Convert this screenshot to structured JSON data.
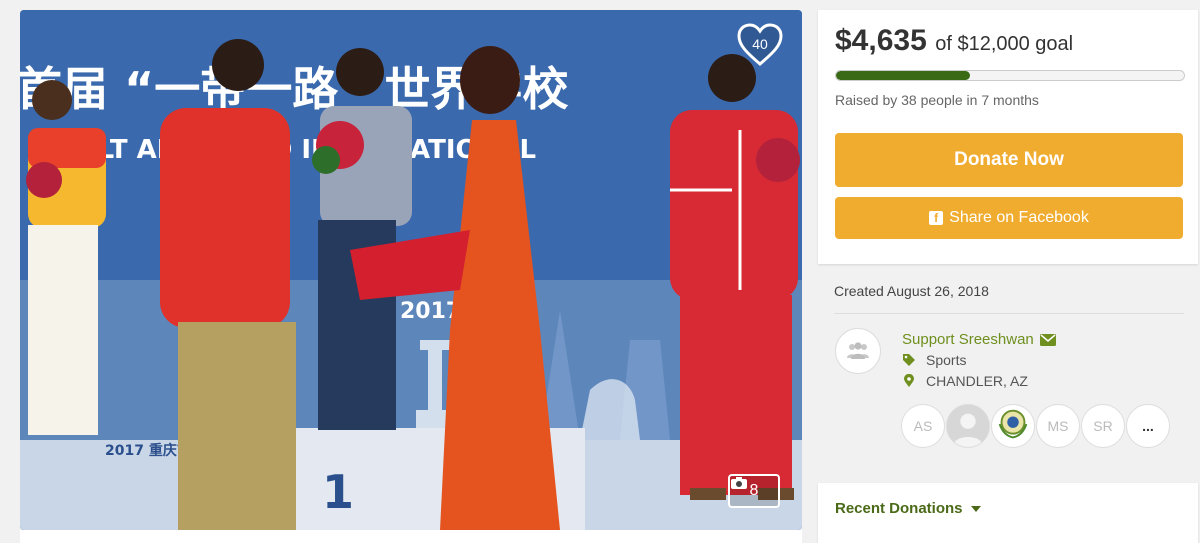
{
  "photo": {
    "like_count": "40",
    "photo_count": "8",
    "sign_texts": {
      "banner_main": "首届 “一带一路” 世界学校",
      "banner_english": "BELT AND ROAD INTERNATIONAL",
      "year_text": "2017年",
      "podium_number": "1",
      "podium_label": "2017 重庆首届 “一带一路”"
    }
  },
  "campaign": {
    "raised": "$4,635",
    "goal_text": "of $12,000 goal",
    "progress": 0.386,
    "raised_by": "Raised by 38 people in 7 months",
    "donate_label": "Donate Now",
    "share_label": "Share on Facebook",
    "created": "Created August 26, 2018"
  },
  "organizer": {
    "name": "Support Sreeshwan",
    "category": "Sports",
    "location": "CHANDLER, AZ"
  },
  "donors": [
    {
      "initials": "AS"
    },
    {
      "initials": ""
    },
    {
      "initials": ""
    },
    {
      "initials": "MS"
    },
    {
      "initials": "SR"
    },
    {
      "initials": "..."
    }
  ],
  "recent": {
    "title": "Recent Donations"
  },
  "colors": {
    "accent": "#f0ac2f",
    "progress": "#3a6a16",
    "link_green": "#6f8f1f"
  }
}
